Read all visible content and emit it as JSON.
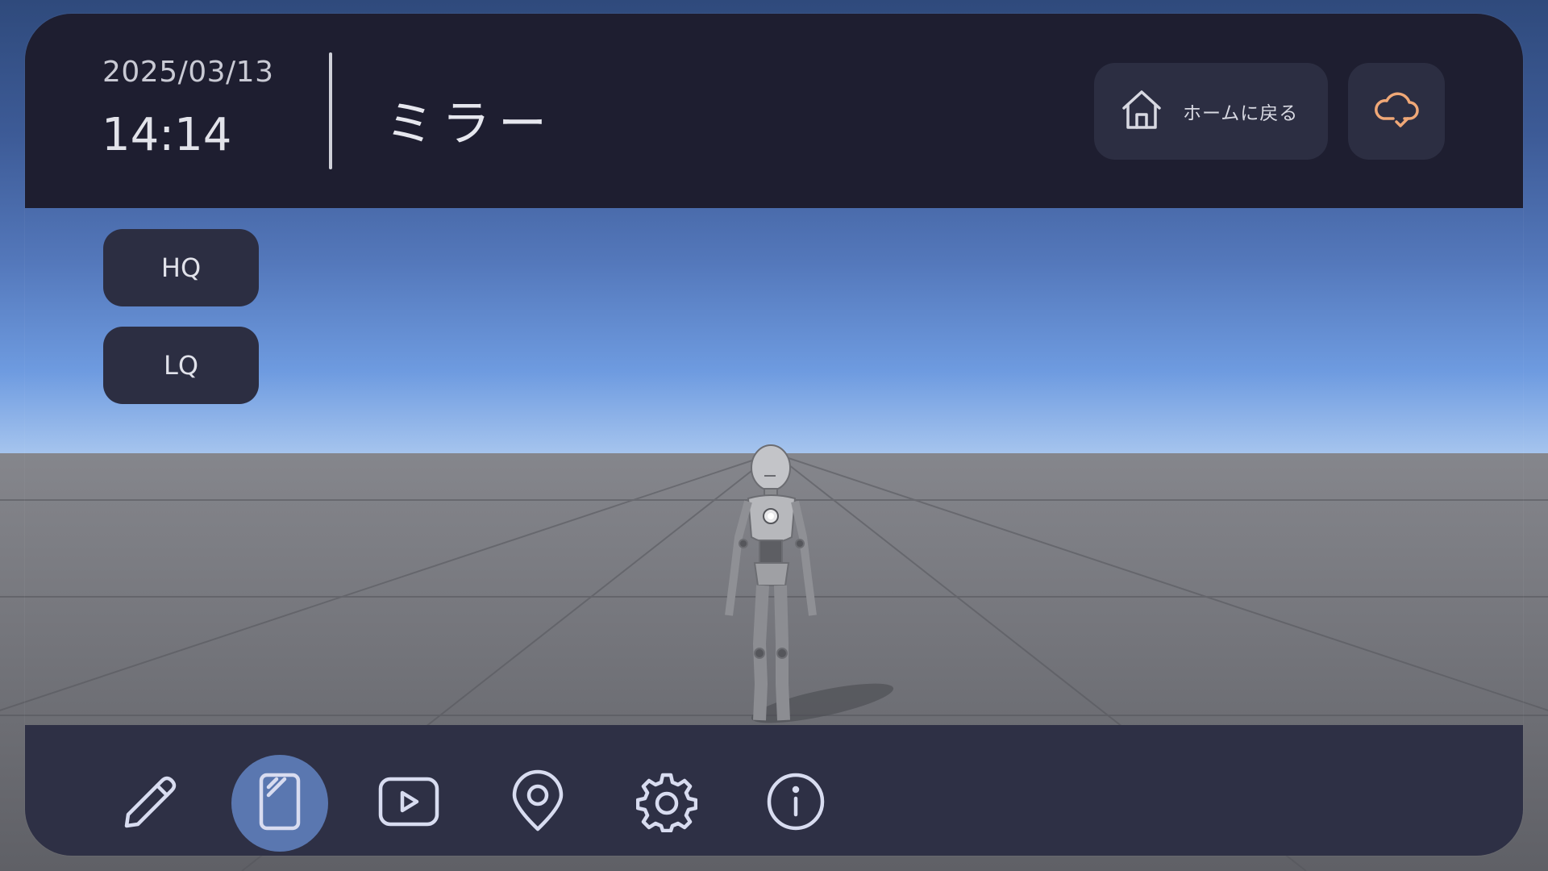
{
  "header": {
    "date": "2025/03/13",
    "time": "14:14",
    "title": "ミラー",
    "home_label": "ホームに戻る",
    "home_icon": "home-icon",
    "cloud_icon": "cloud-check-icon"
  },
  "quality": {
    "hq_label": "HQ",
    "lq_label": "LQ"
  },
  "toolbar": {
    "items": [
      {
        "icon": "pencil-icon",
        "active": false
      },
      {
        "icon": "mirror-icon",
        "active": true
      },
      {
        "icon": "play-icon",
        "active": false
      },
      {
        "icon": "location-pin-icon",
        "active": false
      },
      {
        "icon": "gear-icon",
        "active": false
      },
      {
        "icon": "info-icon",
        "active": false
      }
    ]
  },
  "colors": {
    "header_bg": "#1e1e30",
    "toolbar_bg": "#2e3045",
    "button_bg": "#2c2e42",
    "active_tool": "#5a77b0",
    "cloud_accent": "#f0a877"
  }
}
